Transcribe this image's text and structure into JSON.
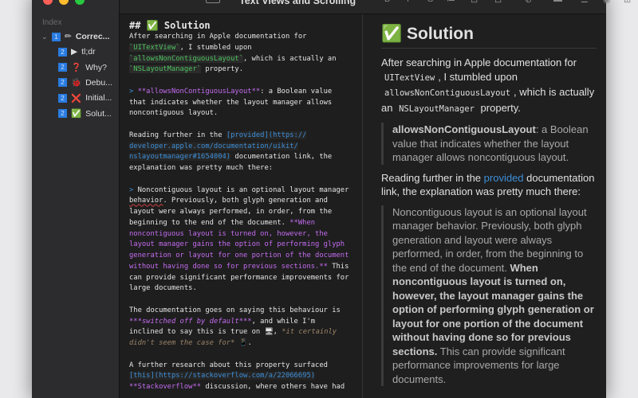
{
  "window": {
    "title": "Text Views and Scrolling"
  },
  "sidebar": {
    "index_label": "Index",
    "items": [
      {
        "level": "1",
        "icon": "✏",
        "label": "Correc...",
        "chevron": "⌄"
      },
      {
        "level": "2",
        "icon": "▶",
        "label": "tl;dr"
      },
      {
        "level": "2",
        "icon": "❓",
        "label": "Why?"
      },
      {
        "level": "2",
        "icon": "🐞",
        "label": "Debu..."
      },
      {
        "level": "2",
        "icon": "❌",
        "label": "Initial..."
      },
      {
        "level": "2",
        "icon": "✅",
        "label": "Solut..."
      }
    ]
  },
  "toolbar": {
    "icons": [
      "#",
      "B",
      "I",
      "S",
      "≔",
      "⊡",
      "⊟",
      "⊘",
      "▬",
      "☰",
      "◉",
      "⊞"
    ]
  },
  "editor": {
    "lines": [
      [
        [
          "h",
          "## ✅ Solution"
        ]
      ],
      [
        [
          "t",
          "After searching in Apple documentation for"
        ]
      ],
      [
        [
          "code",
          "`UITextView`"
        ],
        [
          "t",
          ", I stumbled upon"
        ]
      ],
      [
        [
          "code",
          "`allowsNonContiguousLayout`"
        ],
        [
          "t",
          ", which is actually an"
        ]
      ],
      [
        [
          "code",
          "`NSLayoutManager`"
        ],
        [
          "t",
          " property."
        ]
      ],
      [],
      [
        [
          "q",
          "> "
        ],
        [
          "pur",
          "**allowsNonContiguousLayout**"
        ],
        [
          "t",
          ": a Boolean value"
        ]
      ],
      [
        [
          "t",
          "that indicates whether the layout manager allows"
        ]
      ],
      [
        [
          "t",
          "noncontiguous layout."
        ]
      ],
      [],
      [
        [
          "t",
          "Reading further in the "
        ],
        [
          "link",
          "[provided](https://"
        ]
      ],
      [
        [
          "link",
          "developer.apple.com/documentation/uikit/"
        ]
      ],
      [
        [
          "link",
          "nslayoutmanager#1654004)"
        ],
        [
          "t",
          " documentation link, the"
        ]
      ],
      [
        [
          "t",
          "explanation was pretty much there:"
        ]
      ],
      [],
      [
        [
          "q",
          "> "
        ],
        [
          "t",
          "Noncontiguous layout is an optional layout manager"
        ]
      ],
      [
        [
          "sq",
          "behavior"
        ],
        [
          "t",
          ". Previously, both glyph generation and"
        ]
      ],
      [
        [
          "t",
          "layout were always performed, in order, from the"
        ]
      ],
      [
        [
          "t",
          "beginning to the end of the document. "
        ],
        [
          "pur",
          "**When"
        ]
      ],
      [
        [
          "pur",
          "noncontiguous layout is turned on, however, the"
        ]
      ],
      [
        [
          "pur",
          "layout manager gains the option of performing glyph"
        ]
      ],
      [
        [
          "pur",
          "generation or layout for one portion of the document"
        ]
      ],
      [
        [
          "pur",
          "without having done so for previous sections.**"
        ],
        [
          "t",
          " This"
        ]
      ],
      [
        [
          "t",
          "can provide significant performance improvements for"
        ]
      ],
      [
        [
          "t",
          "large documents."
        ]
      ],
      [],
      [
        [
          "t",
          "The documentation goes on saying this behaviour is"
        ]
      ],
      [
        [
          "puri",
          "***switched off by default***"
        ],
        [
          "t",
          ", and while I'm"
        ]
      ],
      [
        [
          "t",
          "inclined to say this is true on 🖥, "
        ],
        [
          "ital",
          "*it certainly"
        ]
      ],
      [
        [
          "ital",
          "didn't seem the case for*"
        ],
        [
          "t",
          " 📱."
        ]
      ],
      [],
      [
        [
          "t",
          "A further research about this property surfaced"
        ]
      ],
      [
        [
          "link",
          "[this](https://stackoverflow.com/a/22066695)"
        ]
      ],
      [
        [
          "pur",
          "**Stackoverflow**"
        ],
        [
          "t",
          " discussion, where others have had"
        ]
      ]
    ]
  },
  "preview": {
    "heading": "✅ Solution",
    "p1": {
      "a": "After searching in Apple documentation for",
      "c1": "UITextView",
      "b": ", I stumbled upon",
      "c2": "allowsNonContiguousLayout",
      "d": ", which is actually an",
      "c3": "NSLayoutManager",
      "e": "property."
    },
    "q1": {
      "bold": "allowsNonContiguousLayout",
      "rest": ": a Boolean value that indicates whether the layout manager allows noncontiguous layout."
    },
    "p2": {
      "a": "Reading further in the",
      "link": "provided",
      "b": "documentation link, the explanation was pretty much there:"
    },
    "q2": {
      "a": "Noncontiguous layout is an optional layout manager behavior. Previously, both glyph generation and layout were always performed, in order, from the beginning to the end of the document.",
      "bold": "When noncontiguous layout is turned on, however, the layout manager gains the option of performing glyph generation or layout for one portion of the document without having done so for previous sections.",
      "b": "This can provide significant performance improvements for large documents."
    }
  }
}
